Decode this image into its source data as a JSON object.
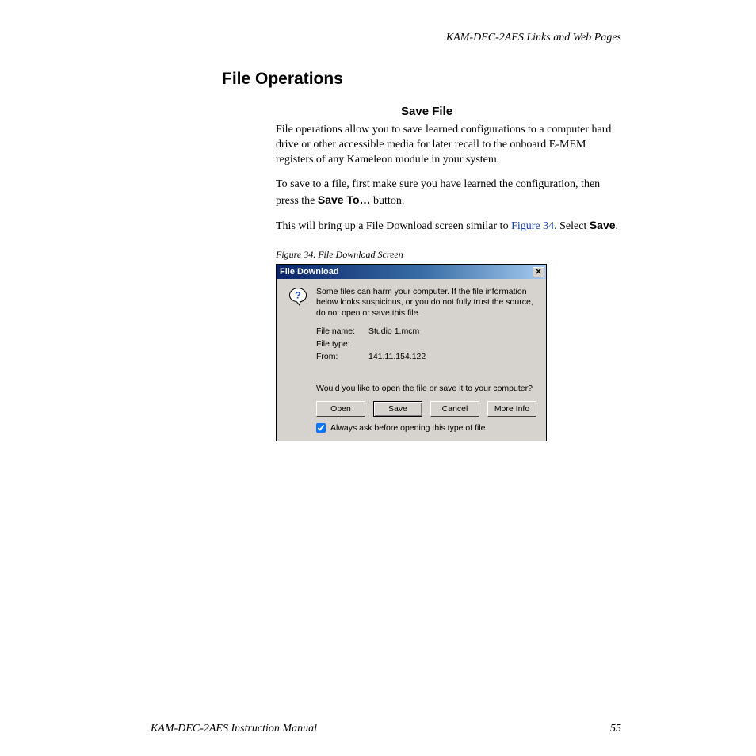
{
  "header": {
    "running_head": "KAM-DEC-2AES Links and Web Pages"
  },
  "section": {
    "title": "File Operations",
    "subtitle": "Save File",
    "para1": "File operations allow you to save learned configurations to a computer hard drive or other accessible media for later recall to the onboard E-MEM registers of any Kameleon module in your system.",
    "para2_pre": "To save to a file, first make sure you have learned the configuration, then press the ",
    "para2_bold": "Save To…",
    "para2_post": " button.",
    "para3_pre": "This will bring up a File Download screen similar to ",
    "para3_link": "Figure 34",
    "para3_mid": ". Select ",
    "para3_bold": "Save",
    "para3_post": ".",
    "figcap": "Figure 34.  File Download Screen"
  },
  "dialog": {
    "title": "File Download",
    "close_glyph": "✕",
    "warning": "Some files can harm your computer. If the file information below looks suspicious, or you do not fully trust the source, do not open or save this file.",
    "filename_label": "File name:",
    "filename_value": "Studio 1.mcm",
    "filetype_label": "File type:",
    "filetype_value": "",
    "from_label": "From:",
    "from_value": "141.11.154.122",
    "prompt": "Would you like to open the file or save it to your computer?",
    "buttons": {
      "open": "Open",
      "save": "Save",
      "cancel": "Cancel",
      "more": "More Info"
    },
    "checkbox": "Always ask before opening this type of file"
  },
  "footer": {
    "manual": "KAM-DEC-2AES Instruction Manual",
    "page": "55"
  }
}
